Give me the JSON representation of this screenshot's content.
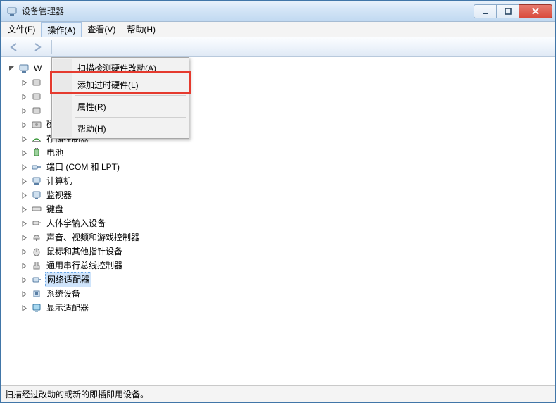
{
  "window": {
    "title": "设备管理器"
  },
  "menu": {
    "file": "文件(F)",
    "action": "操作(A)",
    "view": "查看(V)",
    "help": "帮助(H)"
  },
  "action_menu": {
    "scan": "扫描检测硬件改动(A)",
    "add_legacy": "添加过时硬件(L)",
    "properties": "属性(R)",
    "help": "帮助(H)"
  },
  "tree": {
    "root_visible": "W",
    "items": [
      {
        "label": "磁盘驱动器"
      },
      {
        "label": "存储控制器"
      },
      {
        "label": "电池"
      },
      {
        "label": "端口 (COM 和 LPT)"
      },
      {
        "label": "计算机"
      },
      {
        "label": "监视器"
      },
      {
        "label": "键盘"
      },
      {
        "label": "人体学输入设备"
      },
      {
        "label": "声音、视频和游戏控制器"
      },
      {
        "label": "鼠标和其他指针设备"
      },
      {
        "label": "通用串行总线控制器"
      },
      {
        "label": "网络适配器",
        "selected": true
      },
      {
        "label": "系统设备"
      },
      {
        "label": "显示适配器"
      }
    ]
  },
  "status": "扫描经过改动的或新的即插即用设备。"
}
